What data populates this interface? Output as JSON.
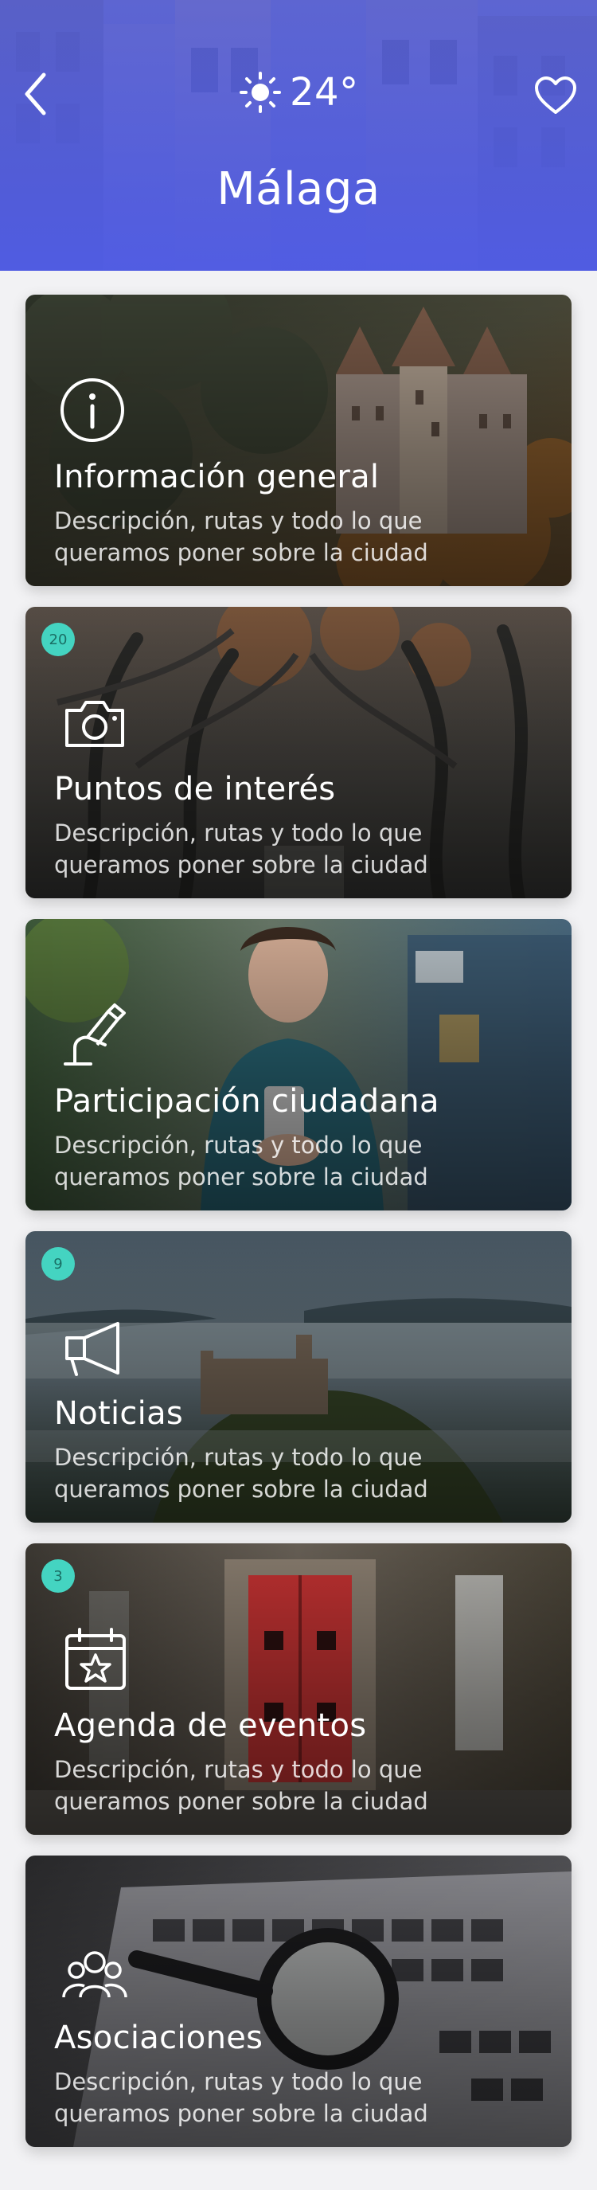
{
  "header": {
    "temperature": "24°",
    "weather_icon": "sun-icon",
    "city": "Málaga",
    "back_icon": "chevron-left-icon",
    "favorite_icon": "heart-icon",
    "color": "#5561d8"
  },
  "badge_color": "#44d4c1",
  "cards": [
    {
      "title": "Información general",
      "description": "Descripción, rutas y todo lo que queramos poner sobre la ciudad",
      "badge": "",
      "icon": "info-icon"
    },
    {
      "title": "Puntos de interés",
      "description": "Descripción, rutas y todo lo que queramos poner sobre la ciudad",
      "badge": "20",
      "icon": "camera-icon"
    },
    {
      "title": "Participación ciudadana",
      "description": "Descripción, rutas y todo lo que queramos poner sobre la ciudad",
      "badge": "",
      "icon": "pen-hand-icon"
    },
    {
      "title": "Noticias",
      "description": "Descripción, rutas y todo lo que queramos poner sobre la ciudad",
      "badge": "9",
      "icon": "megaphone-icon"
    },
    {
      "title": "Agenda de eventos",
      "description": "Descripción, rutas y todo lo que queramos poner sobre la ciudad",
      "badge": "3",
      "icon": "calendar-star-icon"
    },
    {
      "title": "Asociaciones",
      "description": "Descripción, rutas y todo lo que queramos poner sobre la ciudad",
      "badge": "",
      "icon": "people-group-icon"
    }
  ]
}
